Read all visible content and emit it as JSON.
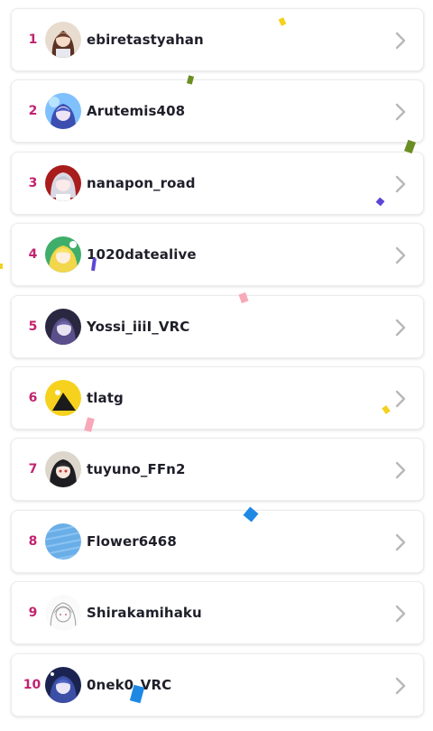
{
  "ranking": {
    "items": [
      {
        "rank": "1",
        "username": "ebiretastyahan",
        "avatar_icon": "avatar-brown-hair-girl-icon"
      },
      {
        "rank": "2",
        "username": "Arutemis408",
        "avatar_icon": "avatar-blue-hair-girl-icon"
      },
      {
        "rank": "3",
        "username": "nanapon_road",
        "avatar_icon": "avatar-silver-hair-girl-icon"
      },
      {
        "rank": "4",
        "username": "1020datealive",
        "avatar_icon": "avatar-yellow-hair-girl-icon"
      },
      {
        "rank": "5",
        "username": "Yossi_iiiI_VRC",
        "avatar_icon": "avatar-dark-purple-girl-icon"
      },
      {
        "rank": "6",
        "username": "tlatg",
        "avatar_icon": "avatar-yellow-duck-icon"
      },
      {
        "rank": "7",
        "username": "tuyuno_FFn2",
        "avatar_icon": "avatar-black-hair-girl-icon"
      },
      {
        "rank": "8",
        "username": "Flower6468",
        "avatar_icon": "avatar-blue-scribble-icon"
      },
      {
        "rank": "9",
        "username": "Shirakamihaku",
        "avatar_icon": "avatar-sketch-girl-icon"
      },
      {
        "rank": "10",
        "username": "0nek0_VRC",
        "avatar_icon": "avatar-navy-hair-girl-icon"
      }
    ]
  },
  "colors": {
    "rank": "#c2226e",
    "name": "#1f1f2a",
    "chevron": "#b8b8b8",
    "confetti": [
      "#f5d020",
      "#6b8e23",
      "#5b46d6",
      "#f7a9b8",
      "#1e88e5"
    ]
  }
}
